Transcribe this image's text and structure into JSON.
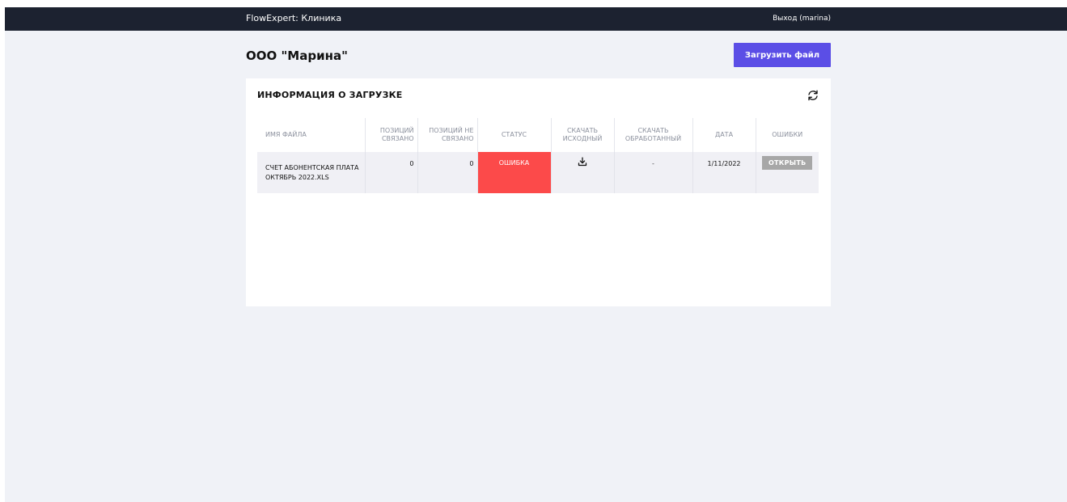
{
  "header": {
    "brand": "FlowExpert: Клиника",
    "logout_label": "Выход (marina)"
  },
  "page": {
    "company_title": "ООО \"Марина\"",
    "upload_button_label": "Загрузить файл"
  },
  "card": {
    "title": "ИНФОРМАЦИЯ О ЗАГРУЗКЕ",
    "refresh_icon": "refresh-icon"
  },
  "table": {
    "columns": [
      "Имя файла",
      "Позиций связано",
      "Позиций не связано",
      "Статус",
      "Скачать исходный",
      "Скачать обработанный",
      "Дата",
      "Ошибки"
    ],
    "rows": [
      {
        "filename": "Счет абонентская плата октябрь 2022.xls",
        "linked": "0",
        "unlinked": "0",
        "status": "Ошибка",
        "download_original_icon": "download-icon",
        "download_processed": "-",
        "date": "1/11/2022",
        "errors_button_label": "Открыть"
      }
    ]
  },
  "colors": {
    "topbar": "#1c2230",
    "page_background": "#f0f2f7",
    "accent": "#5b4ee6",
    "status_error": "#fc4a4a",
    "row_background": "#f0f0f5",
    "open_button": "#a7a7a7"
  }
}
